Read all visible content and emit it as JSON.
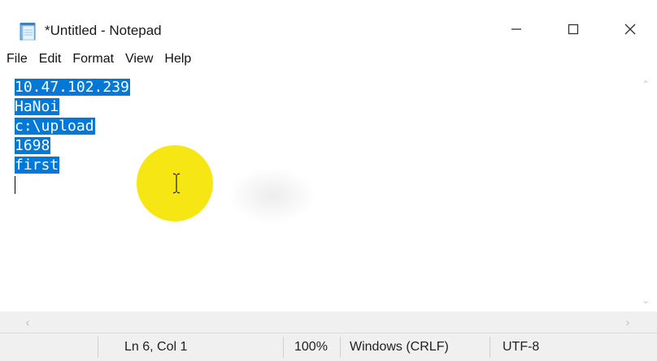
{
  "window": {
    "title": "*Untitled - Notepad",
    "icon": "notepad-icon",
    "controls": {
      "minimize": "minimize-icon",
      "maximize": "maximize-icon",
      "close": "close-icon"
    }
  },
  "menu": {
    "items": [
      "File",
      "Edit",
      "Format",
      "View",
      "Help"
    ]
  },
  "editor": {
    "lines": [
      "10.47.102.239",
      "HaNoi",
      "c:\\upload",
      "1698",
      "first",
      ""
    ],
    "selection_color": "#0078d7",
    "cursor_highlight_color": "#f5e500"
  },
  "statusbar": {
    "position": "Ln 6, Col 1",
    "zoom": "100%",
    "line_ending": "Windows (CRLF)",
    "encoding": "UTF-8"
  }
}
